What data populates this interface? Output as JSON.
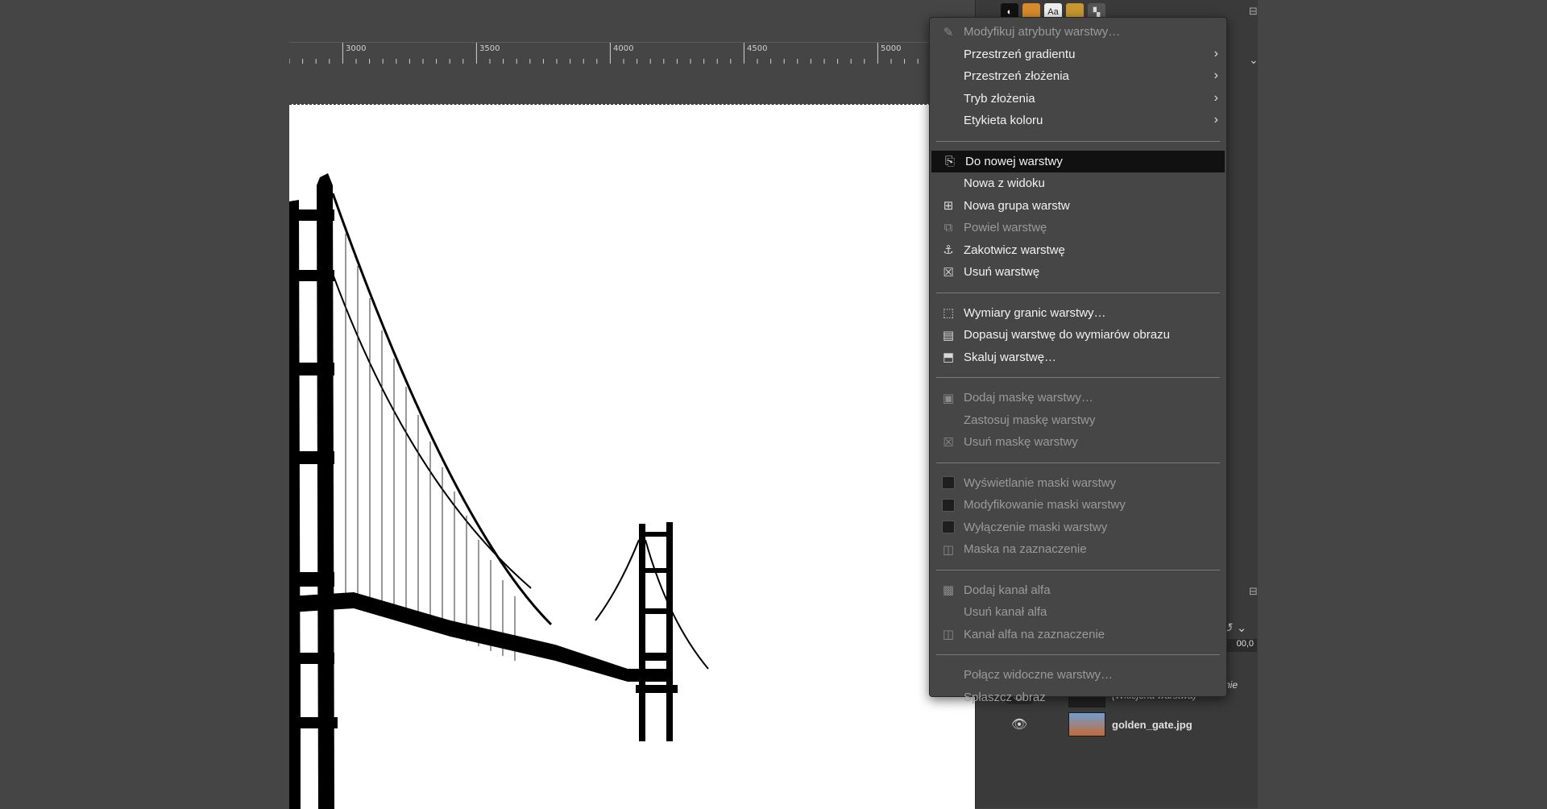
{
  "ruler": {
    "labels": [
      "3000",
      "3500",
      "4000",
      "4500",
      "5000"
    ]
  },
  "layers": [
    {
      "name": "(Wkiejona warstwa)",
      "partial": "nie"
    },
    {
      "name": "golden_gate.jpg"
    }
  ],
  "spin_value": "00,0",
  "menu": {
    "items": [
      {
        "label": "Modyfikuj atrybuty warstwy…",
        "icon": "pencil-icon",
        "disabled": true
      },
      {
        "label": "Przestrzeń gradientu",
        "submenu": true
      },
      {
        "label": "Przestrzeń złożenia",
        "submenu": true
      },
      {
        "label": "Tryb złożenia",
        "submenu": true
      },
      {
        "label": "Etykieta koloru",
        "submenu": true
      },
      {
        "sep": true
      },
      {
        "label": "Do nowej warstwy",
        "icon": "new-layer-icon",
        "highlighted": true
      },
      {
        "label": "Nowa z widoku"
      },
      {
        "label": "Nowa grupa warstw",
        "icon": "new-group-icon"
      },
      {
        "label": "Powiel warstwę",
        "icon": "duplicate-icon",
        "disabled": true
      },
      {
        "label": "Zakotwicz warstwę",
        "icon": "anchor-icon"
      },
      {
        "label": "Usuń warstwę",
        "icon": "delete-icon"
      },
      {
        "sep": true
      },
      {
        "label": "Wymiary granic warstwy…",
        "icon": "resize-icon"
      },
      {
        "label": "Dopasuj warstwę do wymiarów obrazu",
        "icon": "fit-image-icon"
      },
      {
        "label": "Skaluj warstwę…",
        "icon": "scale-icon"
      },
      {
        "sep": true
      },
      {
        "label": "Dodaj maskę warstwy…",
        "icon": "add-mask-icon",
        "disabled": true
      },
      {
        "label": "Zastosuj maskę warstwy",
        "disabled": true
      },
      {
        "label": "Usuń maskę warstwy",
        "icon": "delete-icon",
        "disabled": true
      },
      {
        "sep": true
      },
      {
        "label": "Wyświetlanie maski warstwy",
        "checkbox": true,
        "disabled": true
      },
      {
        "label": "Modyfikowanie maski warstwy",
        "checkbox": true,
        "disabled": true
      },
      {
        "label": "Wyłączenie maski warstwy",
        "checkbox": true,
        "disabled": true
      },
      {
        "label": "Maska na zaznaczenie",
        "icon": "mask-selection-icon",
        "disabled": true
      },
      {
        "sep": true
      },
      {
        "label": "Dodaj kanał alfa",
        "icon": "alpha-icon",
        "disabled": true
      },
      {
        "label": "Usuń kanał alfa",
        "disabled": true
      },
      {
        "label": "Kanał alfa na zaznaczenie",
        "icon": "alpha-selection-icon",
        "disabled": true
      },
      {
        "sep": true
      },
      {
        "label": "Połącz widoczne warstwy…",
        "disabled": true
      },
      {
        "label": "Spłaszcz obraz",
        "disabled": true
      }
    ]
  }
}
